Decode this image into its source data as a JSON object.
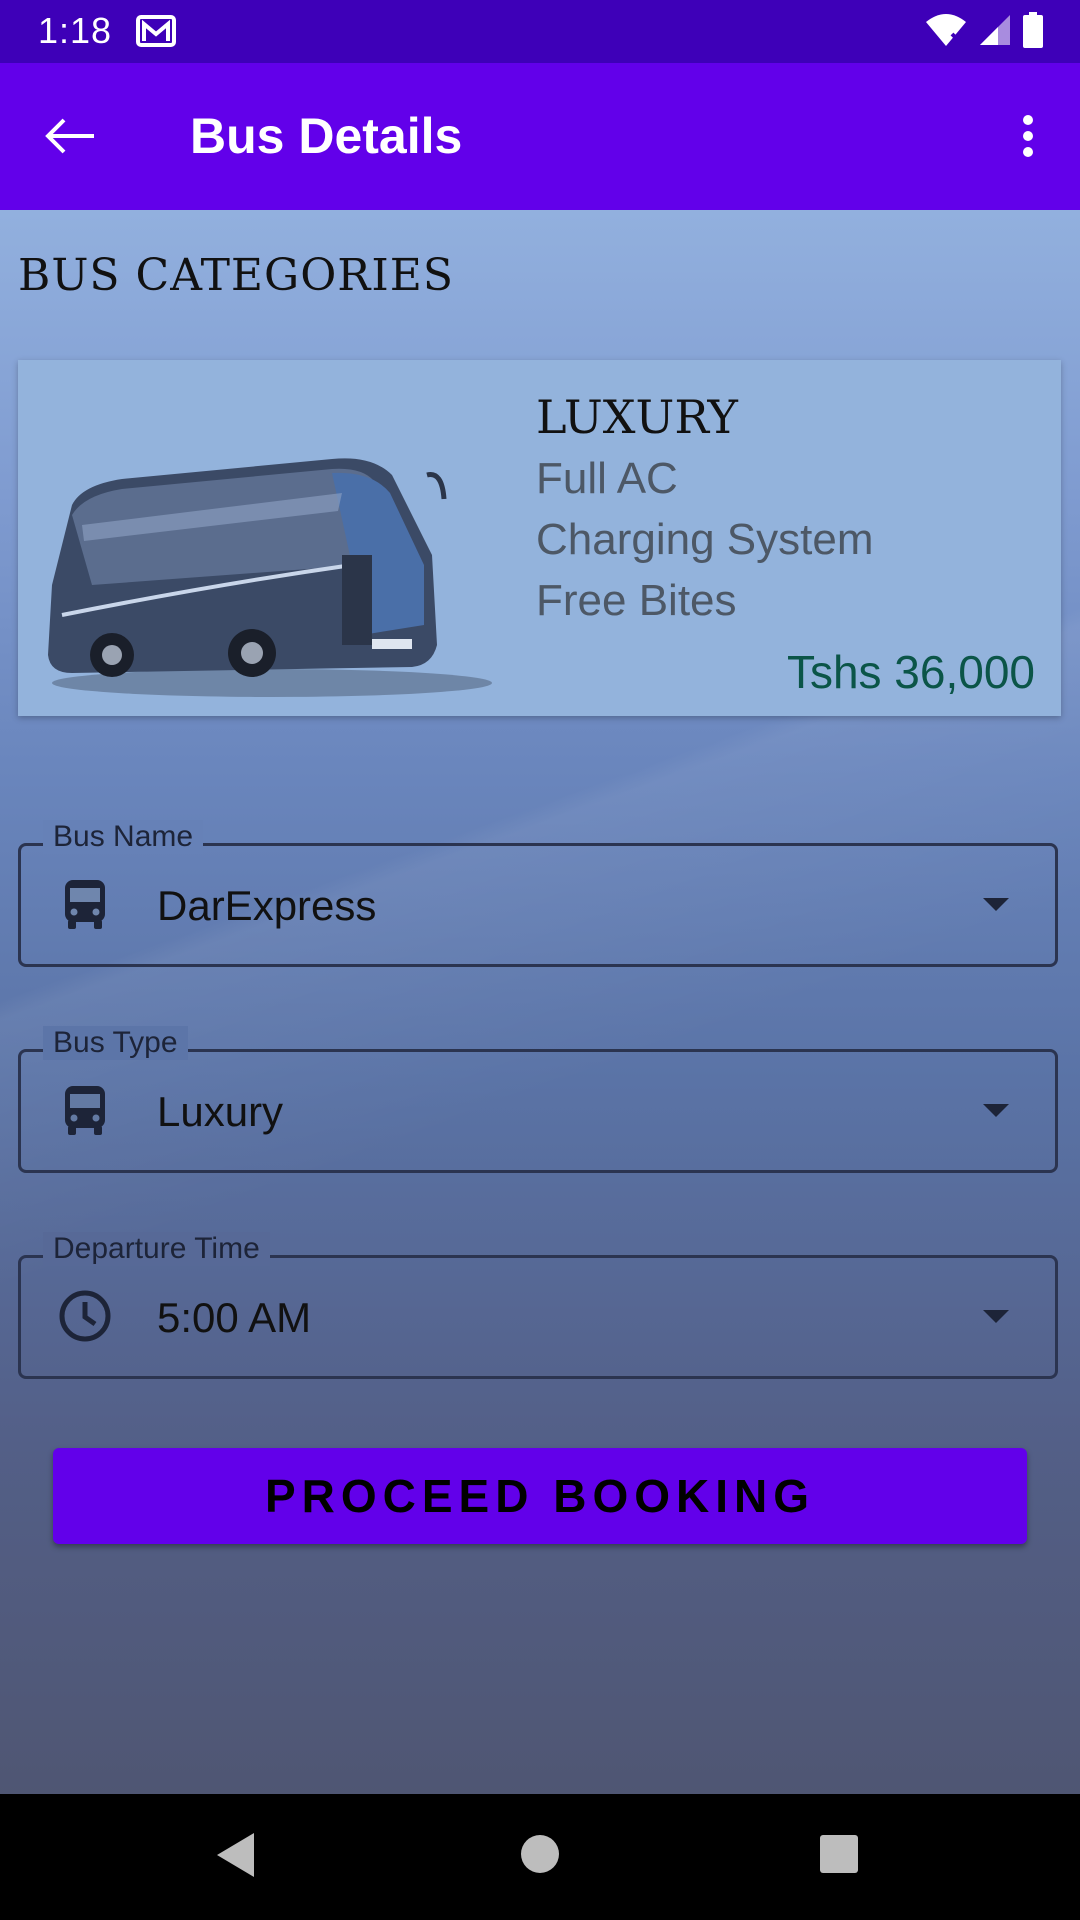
{
  "status_bar": {
    "time": "1:18",
    "icons": [
      "gmail-icon",
      "wifi-icon",
      "signal-icon",
      "battery-icon"
    ]
  },
  "app_bar": {
    "title": "Bus Details",
    "back_icon": "arrow-back-icon",
    "menu_icon": "more-vert-icon",
    "color": "#6200ea"
  },
  "section": {
    "title": "BUS CATEGORIES"
  },
  "category_card": {
    "title": "LUXURY",
    "features": [
      "Full AC",
      "Charging System",
      "Free Bites"
    ],
    "price": "Tshs 36,000"
  },
  "form": {
    "bus_name": {
      "label": "Bus Name",
      "value": "DarExpress",
      "icon": "bus-icon"
    },
    "bus_type": {
      "label": "Bus Type",
      "value": "Luxury",
      "icon": "bus-icon"
    },
    "departure_time": {
      "label": "Departure Time",
      "value": "5:00 AM",
      "icon": "clock-icon"
    }
  },
  "proceed_button": {
    "label": "PROCEED BOOKING"
  },
  "nav_bar": {
    "icons": [
      "nav-back-icon",
      "nav-home-icon",
      "nav-recents-icon"
    ]
  }
}
